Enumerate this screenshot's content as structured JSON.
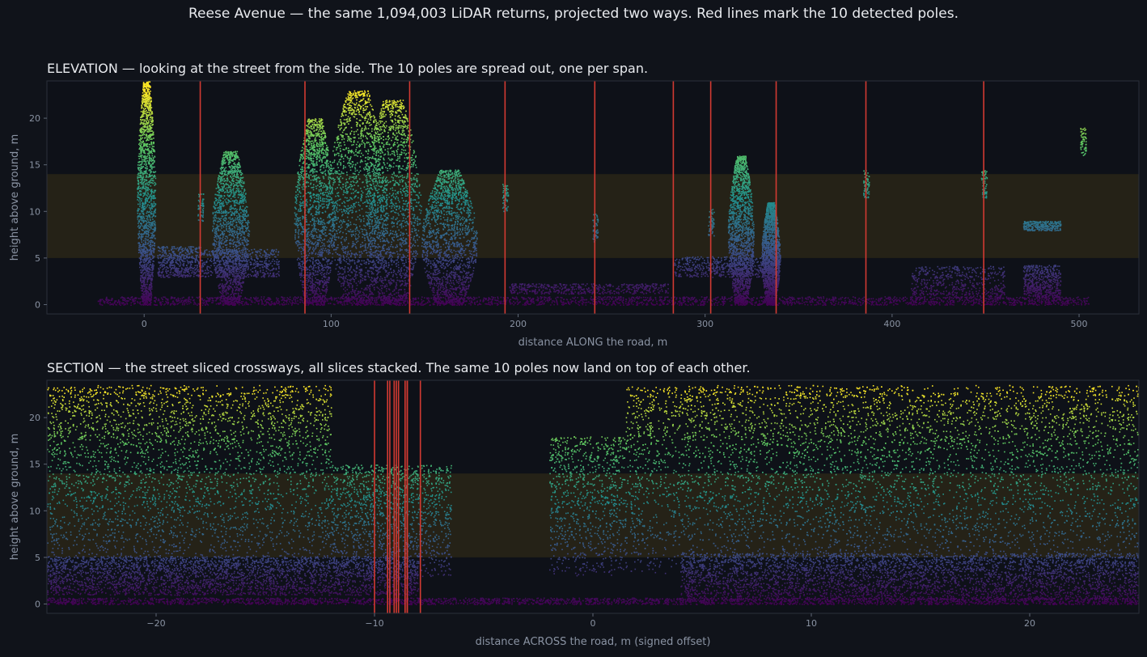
{
  "figure": {
    "title": "Reese Avenue  —  the same 1,094,003 LiDAR returns, projected two ways. Red lines mark the 10 detected poles."
  },
  "colors": {
    "background": "#10131a",
    "panel": "#0e1118",
    "band": "#252217",
    "pole_line": "#d23a32",
    "colormap": [
      "#440154",
      "#3b528b",
      "#21918c",
      "#5ec962",
      "#fde725"
    ]
  },
  "chart_data": [
    {
      "type": "scatter",
      "title": "ELEVATION  —  looking at the street from the side.  The 10 poles are spread out, one per span.",
      "xlabel": "distance ALONG the road, m",
      "ylabel": "height above ground, m",
      "xlim": [
        -52,
        532
      ],
      "ylim": [
        -1,
        24
      ],
      "xticks": [
        0,
        100,
        200,
        300,
        400,
        500
      ],
      "yticks": [
        0,
        5,
        10,
        15,
        20
      ],
      "highlight_band_y": [
        5,
        14
      ],
      "pole_x": [
        30,
        86,
        142,
        193,
        241,
        283,
        303,
        338,
        386,
        449
      ],
      "grid": false,
      "color_by": "height",
      "tree_clusters": [
        {
          "x": [
            -4,
            6
          ],
          "top": 24
        },
        {
          "x": [
            36,
            56
          ],
          "top": 16.5
        },
        {
          "x": [
            80,
            102
          ],
          "top": 20
        },
        {
          "x": [
            98,
            130
          ],
          "top": 23
        },
        {
          "x": [
            118,
            148
          ],
          "top": 22
        },
        {
          "x": [
            148,
            178
          ],
          "top": 14.5
        },
        {
          "x": [
            312,
            326
          ],
          "top": 16
        },
        {
          "x": [
            330,
            340
          ],
          "top": 11
        }
      ],
      "structures": [
        {
          "x": [
            7,
            30
          ],
          "z": [
            3,
            6.3
          ]
        },
        {
          "x": [
            30,
            72
          ],
          "z": [
            3,
            6
          ]
        },
        {
          "x": [
            195,
            280
          ],
          "z": [
            1.2,
            2.3
          ]
        },
        {
          "x": [
            283,
            340
          ],
          "z": [
            3,
            5.2
          ]
        },
        {
          "x": [
            410,
            460
          ],
          "z": [
            0.8,
            4.2
          ]
        },
        {
          "x": [
            470,
            490
          ],
          "z": [
            0.8,
            4.3
          ]
        }
      ],
      "pole_tops": [
        {
          "x": 30,
          "z": 12
        },
        {
          "x": 193,
          "z": 13
        },
        {
          "x": 241,
          "z": 9.8
        },
        {
          "x": 303,
          "z": 10.4
        },
        {
          "x": 386,
          "z": 14.5
        },
        {
          "x": 449,
          "z": 14.5
        },
        {
          "x": 502,
          "z": 19
        }
      ],
      "features": [
        {
          "x": [
            470,
            490
          ],
          "z": [
            8,
            9
          ]
        }
      ]
    },
    {
      "type": "scatter",
      "title": "SECTION  —  the street sliced crossways, all slices stacked.  The same 10 poles now land on top of each other.",
      "xlabel": "distance ACROSS the road, m (signed offset)",
      "ylabel": "height above ground, m",
      "xlim": [
        -25,
        25
      ],
      "ylim": [
        -1,
        24
      ],
      "xticks": [
        -20,
        -10,
        0,
        10,
        20
      ],
      "yticks": [
        0,
        5,
        10,
        15,
        20
      ],
      "highlight_band_y": [
        5,
        14
      ],
      "pole_x": [
        -10.0,
        -9.4,
        -9.3,
        -9.1,
        -9.0,
        -8.9,
        -8.6,
        -8.5,
        -8.5,
        -7.9
      ],
      "grid": false,
      "color_by": "height",
      "canopy": [
        {
          "x": [
            -25,
            -12
          ],
          "top": 23.5
        },
        {
          "x": [
            -12,
            -6.5
          ],
          "top": 15
        },
        {
          "x": [
            -2,
            1.5
          ],
          "top": 18
        },
        {
          "x": [
            1.5,
            25
          ],
          "top": 23.5
        }
      ],
      "structure_layers": [
        {
          "x": [
            -25,
            -8
          ],
          "z": [
            1,
            5.2
          ]
        },
        {
          "x": [
            4,
            25
          ],
          "z": [
            0.5,
            5.5
          ]
        }
      ]
    }
  ]
}
